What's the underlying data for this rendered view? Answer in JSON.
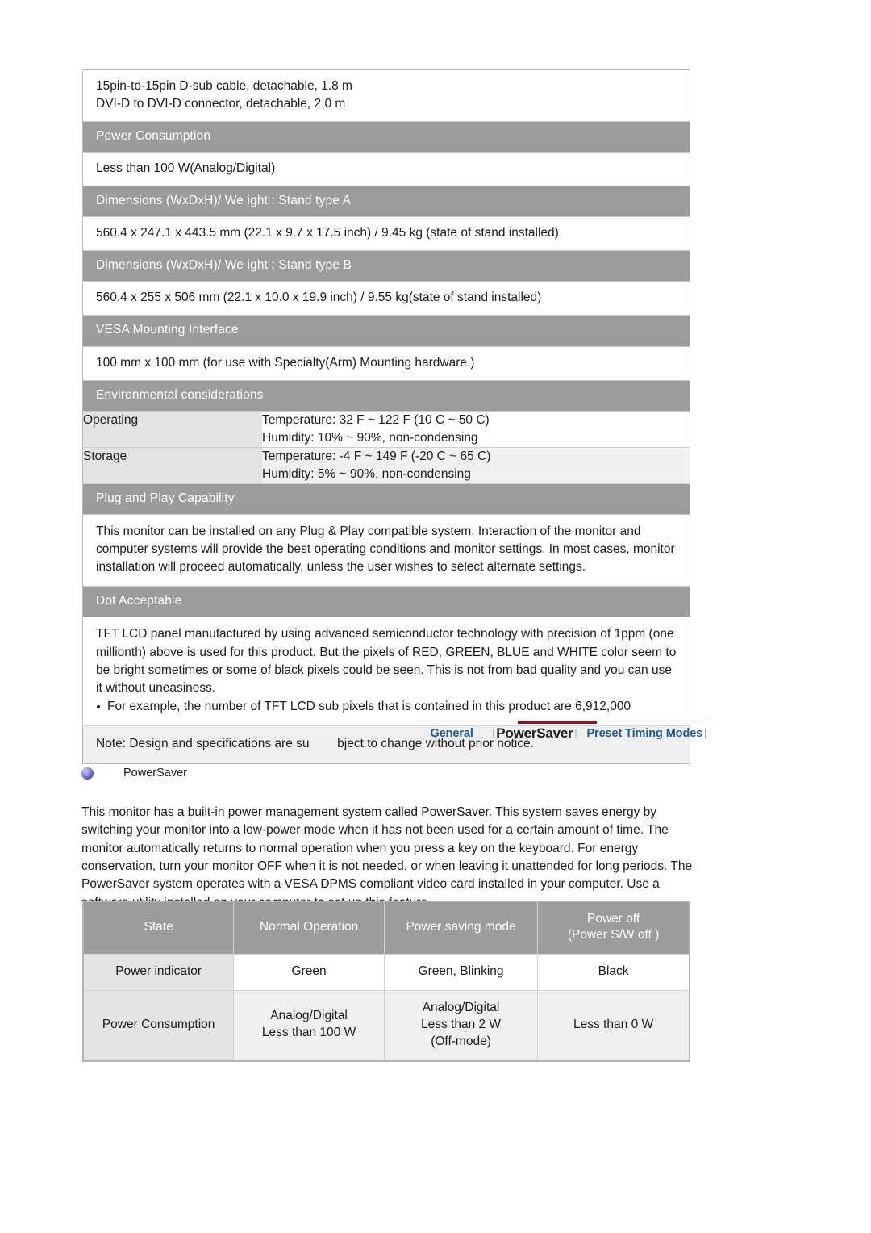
{
  "spec_table": {
    "cable_row": {
      "line1": "15pin-to-15pin D-sub cable, detachable, 1.8 m",
      "line2": "DVI-D to DVI-D connector, detachable, 2.0 m"
    },
    "power_consumption_header": "Power Consumption",
    "power_consumption_value": "Less than 100 W(Analog/Digital)",
    "dimensions_a_header": "Dimensions (WxDxH)/ We ight : Stand type A",
    "dimensions_a_value": "560.4 x 247.1 x 443.5 mm (22.1 x 9.7 x 17.5 inch) / 9.45 kg (state of stand installed)",
    "dimensions_b_header": "Dimensions (WxDxH)/ We ight : Stand type B",
    "dimensions_b_value": "560.4 x 255 x 506 mm (22.1 x 10.0 x 19.9 inch) / 9.55 kg(state of stand installed)",
    "vesa_header": "VESA Mounting Interface",
    "vesa_value": "100 mm x 100 mm (for use with Specialty(Arm) Mounting hardware.)",
    "environmental_header": "Environmental considerations",
    "operating_label": "Operating",
    "operating_temperature": "Temperature: 32 F ~ 122 F (10 C ~ 50 C)",
    "operating_humidity": "Humidity: 10% ~ 90%, non-condensing",
    "storage_label": "Storage",
    "storage_temperature": "Temperature: -4 F ~ 149 F (-20 C ~ 65 C)",
    "storage_humidity": "Humidity: 5% ~ 90%, non-condensing",
    "plug_play_header": "Plug and Play Capability",
    "plug_play_body": "This monitor can be installed on any Plug & Play compatible system. Interaction of the monitor and computer systems will provide the best operating conditions and monitor settings. In most cases, monitor installation will proceed automatically, unless the user wishes to select alternate settings.",
    "dot_acceptable_header": "Dot Acceptable",
    "dot_acceptable_body": "TFT LCD panel manufactured by using advanced semiconductor technology with precision of 1ppm (one millionth) above is used for this product. But the pixels of RED, GREEN, BLUE and WHITE color seem to be bright sometimes or some of black pixels could be seen. This is not from bad quality and you can use it without uneasiness.",
    "dot_acceptable_bullet": "For example, the number of TFT LCD sub pixels that is contained in this product are 6,912,000",
    "note_part1": "Note: Design and specifications are su",
    "note_part2": "bject to change without prior notice."
  },
  "tabs": {
    "items": [
      {
        "label": "General",
        "active": false
      },
      {
        "label": "PowerSaver",
        "active": true
      },
      {
        "label": "Preset Timing Modes",
        "active": false
      }
    ],
    "separator": "|",
    "active_color": "#8a1621",
    "link_color": "#1d5a8e"
  },
  "section": {
    "heading": "PowerSaver",
    "intro": "This monitor has a built-in power management system called PowerSaver. This system saves energy by switching your monitor into a low-power mode when it has not been used for a certain amount of time. The monitor automatically returns to normal operation when you press a key on the keyboard. For energy conservation, turn your monitor OFF when it is not needed, or when leaving it unattended for long periods. The PowerSaver system operates with a VESA DPMS compliant video card installed in your computer. Use a software utility installed on your computer to set up this feature."
  },
  "powersaver_table": {
    "headers": {
      "state": "State",
      "normal": "Normal Operation",
      "saving": "Power saving mode",
      "off_line1": "Power off",
      "off_line2": "(Power S/W off )"
    },
    "rows": [
      {
        "label": "Power indicator",
        "normal": [
          "Green"
        ],
        "saving": [
          "Green, Blinking"
        ],
        "off": [
          "Black"
        ]
      },
      {
        "label": "Power Consumption",
        "normal": [
          "Analog/Digital",
          "Less than 100 W"
        ],
        "saving": [
          "Analog/Digital",
          "Less than 2 W",
          "(Off-mode)"
        ],
        "off": [
          "Less than 0 W"
        ]
      }
    ]
  }
}
